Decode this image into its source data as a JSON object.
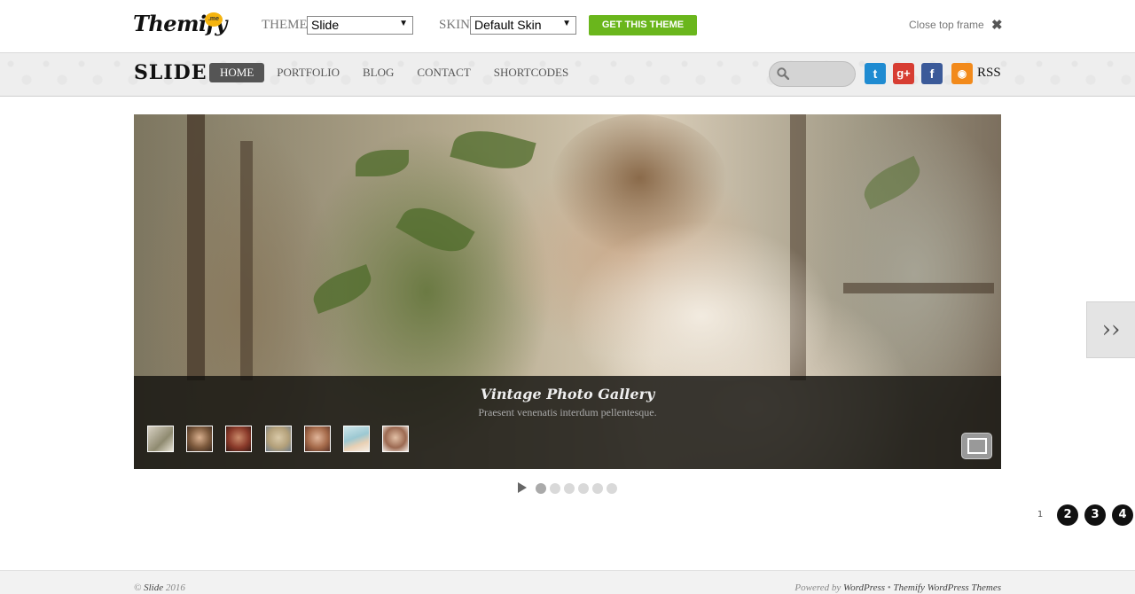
{
  "topframe": {
    "logo_text": "Themify",
    "logo_badge": ".me",
    "theme_label": "THEME",
    "theme_value": "Slide",
    "skin_label": "SKIN",
    "skin_value": "Default Skin",
    "get_button": "GET THIS THEME",
    "close_label": "Close top frame",
    "close_icon": "✖"
  },
  "header": {
    "site_title": "SLIDE",
    "nav": [
      {
        "label": "HOME",
        "active": true
      },
      {
        "label": "PORTFOLIO"
      },
      {
        "label": "BLOG"
      },
      {
        "label": "CONTACT"
      },
      {
        "label": "SHORTCODES"
      }
    ],
    "social": [
      {
        "icon": "twitter-icon",
        "glyph": "t",
        "color": "#1f8bd1"
      },
      {
        "icon": "google-plus-icon",
        "glyph": "g+",
        "color": "#d73d32"
      },
      {
        "icon": "facebook-icon",
        "glyph": "f",
        "color": "#3b5a99"
      },
      {
        "icon": "rss-icon",
        "glyph": "◉",
        "color": "#f28a1b"
      }
    ],
    "rss_label": "RSS"
  },
  "slider": {
    "caption_title": "Vintage Photo Gallery",
    "caption_subtitle": "Praesent venenatis interdum pellentesque.",
    "thumb_count": 7,
    "next_glyph": "››",
    "pager_count": 6,
    "pager_active": 0
  },
  "pagination": {
    "current": "1",
    "pages": [
      "2",
      "3",
      "4"
    ]
  },
  "footer": {
    "copyright_symbol": "©",
    "site_link": "Slide",
    "year": "2016",
    "powered_by": "Powered by",
    "wordpress_link": "WordPress",
    "separator": "•",
    "themify_link": "Themify WordPress Themes"
  },
  "colors": {
    "accent_green": "#6ab61c",
    "nav_active": "#555555"
  }
}
